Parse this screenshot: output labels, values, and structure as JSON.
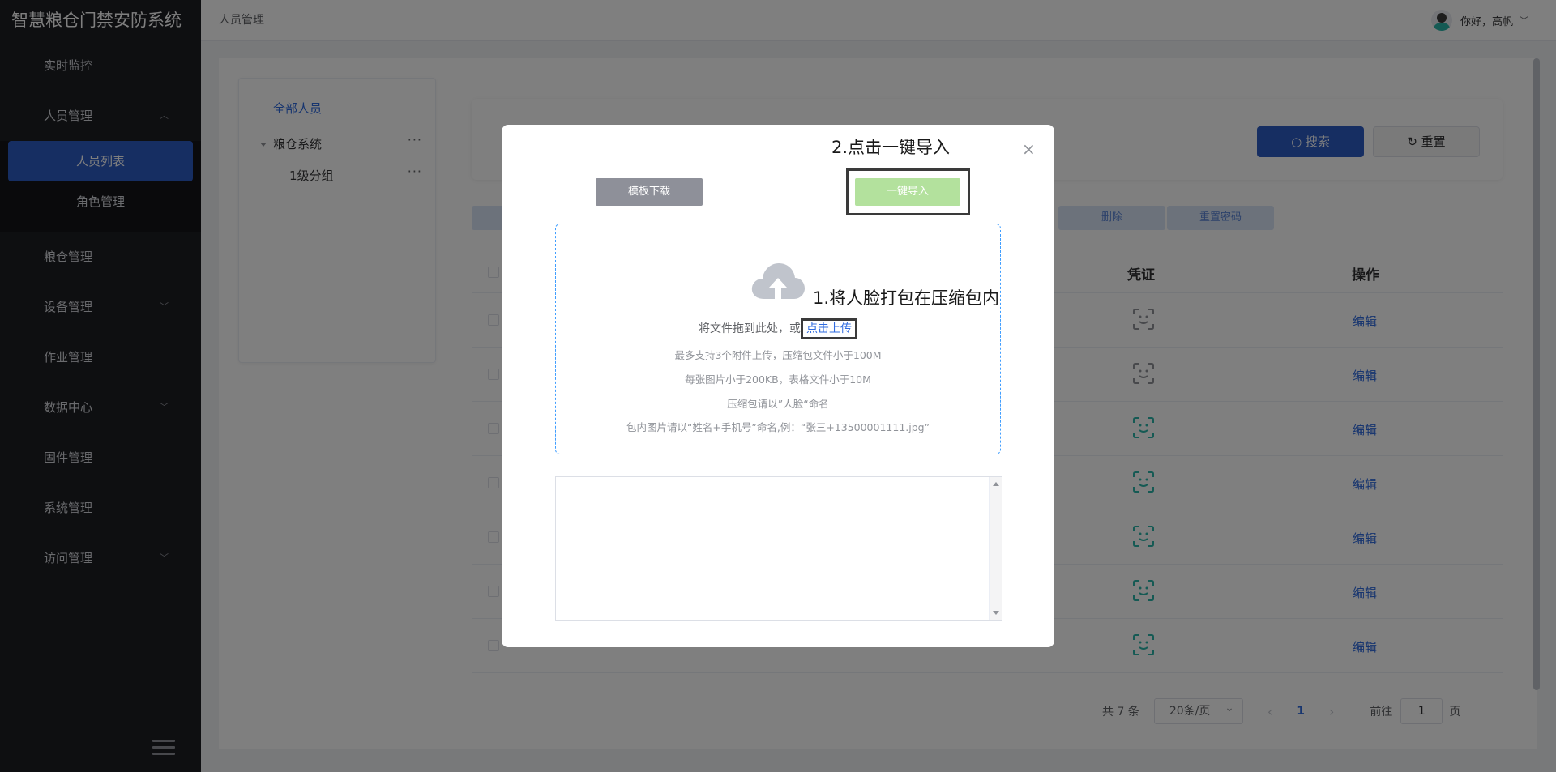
{
  "app": {
    "title": "智慧粮仓门禁安防系统"
  },
  "sidebar": {
    "items": [
      {
        "label": "实时监控"
      },
      {
        "label": "人员管理"
      },
      {
        "label": "粮仓管理"
      },
      {
        "label": "设备管理"
      },
      {
        "label": "作业管理"
      },
      {
        "label": "数据中心"
      },
      {
        "label": "固件管理"
      },
      {
        "label": "系统管理"
      },
      {
        "label": "访问管理"
      }
    ],
    "sub_items": [
      {
        "label": "人员列表",
        "active": true
      },
      {
        "label": "角色管理",
        "active": false
      }
    ]
  },
  "header": {
    "breadcrumb": "人员管理",
    "greeting": "你好，高帆"
  },
  "tree": {
    "all": "全部人员",
    "nodes": [
      {
        "label": "粮仓系统",
        "more": "···"
      },
      {
        "label": "1级分组",
        "more": "···"
      }
    ]
  },
  "search": {
    "search_label": "搜索",
    "reset_label": "重置"
  },
  "toolbar": {
    "delete_label": "删除",
    "reset_pwd_label": "重置密码"
  },
  "table": {
    "columns": {
      "credential": "凭证",
      "action": "操作"
    },
    "rows": [
      {
        "face_active": false,
        "edit": "编辑"
      },
      {
        "face_active": false,
        "edit": "编辑"
      },
      {
        "face_active": true,
        "edit": "编辑"
      },
      {
        "face_active": true,
        "edit": "编辑"
      },
      {
        "face_active": true,
        "edit": "编辑"
      },
      {
        "face_active": true,
        "edit": "编辑"
      },
      {
        "face_active": true,
        "edit": "编辑"
      }
    ]
  },
  "pagination": {
    "total": "共 7 条",
    "page_size": "20条/页",
    "prev": "‹",
    "current": "1",
    "next": "›",
    "goto_label": "前往",
    "goto_value": "1",
    "page_suffix": "页"
  },
  "dialog": {
    "annotation_import": "2.点击一键导入",
    "template_button": "模板下载",
    "import_button": "一键导入",
    "annotation_pack": "1.将人脸打包在压缩包内",
    "drop_text": "将文件拖到此处，或",
    "upload_link": "点击上传",
    "hint_1": "最多支持3个附件上传，压缩包文件小于100M",
    "hint_2": "每张图片小于200KB，表格文件小于10M",
    "hint_3": "压缩包请以”人脸“命名",
    "hint_4": "包内图片请以“姓名+手机号”命名,例：“张三+13500001111.jpg”",
    "close": "×"
  },
  "colors": {
    "primary": "#2d5cc5",
    "link": "#2f6bdf",
    "import_disabled": "#b3e19d",
    "template_btn": "#8e9099",
    "face_active": "#2bb5a8",
    "face_inactive": "#909399"
  }
}
